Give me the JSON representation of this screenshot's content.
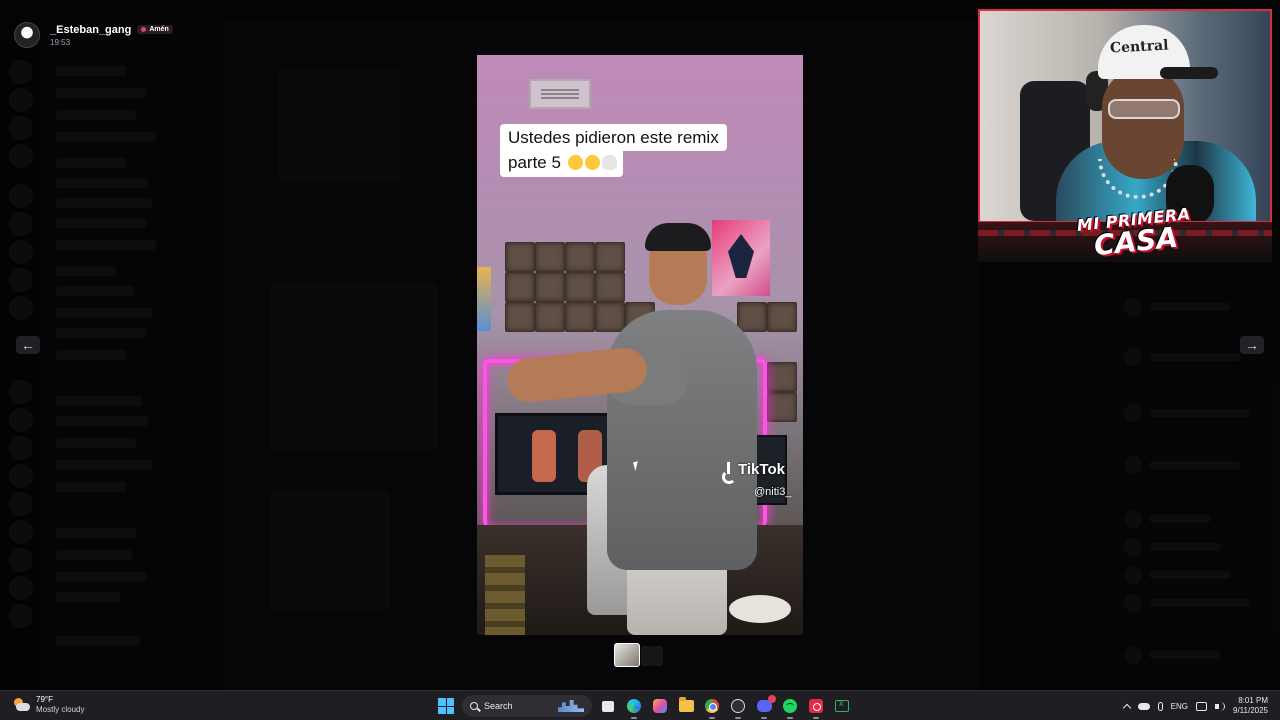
{
  "uploader": {
    "username": "_Esteban_gang",
    "role": "Amén",
    "time": "19:53"
  },
  "video": {
    "caption_line1": "Ustedes pidieron este remix",
    "caption_line2": "parte 5",
    "watermark_brand": "TikTok",
    "watermark_handle": "@niti3_"
  },
  "viewer": {
    "prev_label": "←",
    "next_label": "→"
  },
  "webcam": {
    "hat_text": "Central",
    "logo_line1": "MI PRIMERA",
    "logo_line2": "CASA"
  },
  "taskbar": {
    "weather_temp": "79°F",
    "weather_desc": "Mostly cloudy",
    "search_label": "Search",
    "language": "ENG",
    "time": "8:01 PM",
    "date": "9/11/2025"
  },
  "colors": {
    "accent": "#5865f2",
    "neon": "#ff52e8",
    "logo_red": "#c8102e",
    "role_dot": "#e0465b"
  }
}
